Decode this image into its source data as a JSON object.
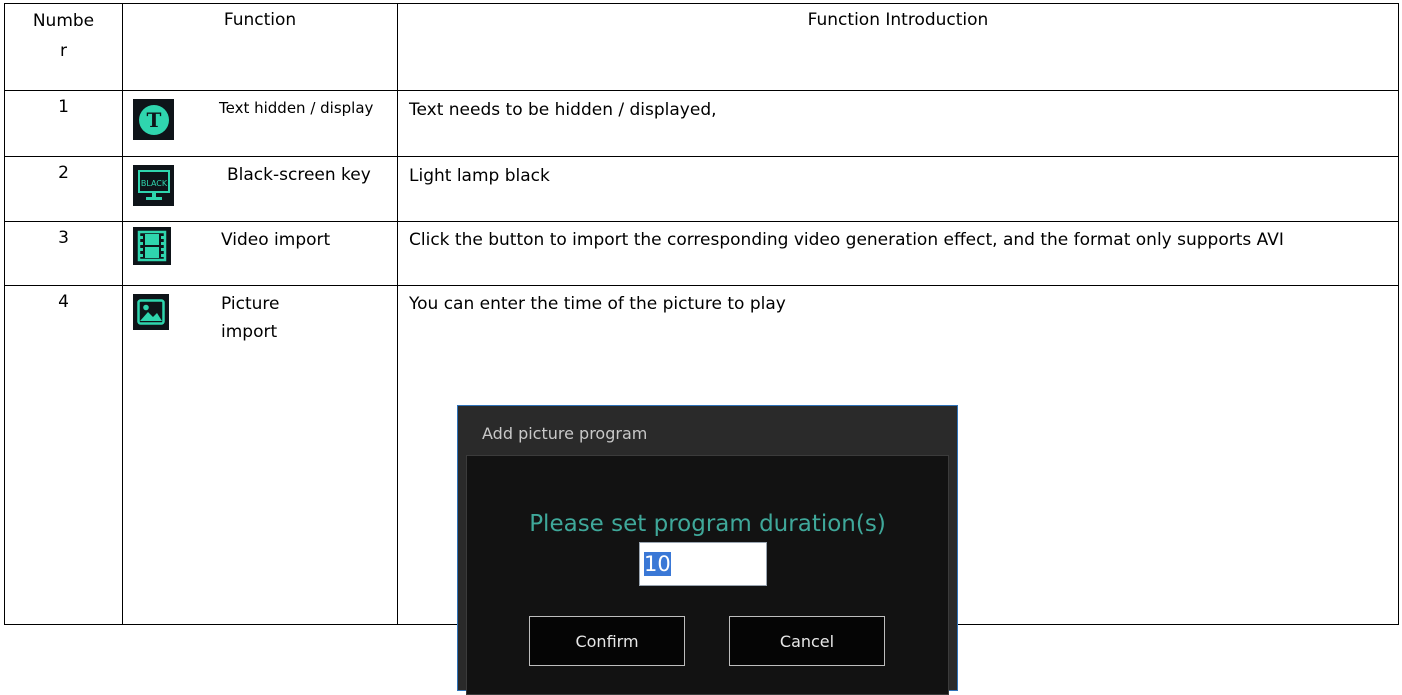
{
  "table": {
    "headers": {
      "number": "Numbe r",
      "function": "Function",
      "intro": "Function Introduction"
    },
    "rows": [
      {
        "number": "1",
        "icon": "text-t-icon",
        "function": "Text hidden / display",
        "intro": "Text needs to be hidden / displayed,"
      },
      {
        "number": "2",
        "icon": "black-screen-monitor-icon",
        "icon_text": "BLACK",
        "function": "Black-screen key",
        "intro": "Light lamp black"
      },
      {
        "number": "3",
        "icon": "film-strip-icon",
        "function": "Video import",
        "intro": "Click the button to import the corresponding video generation effect, and the format only supports AVI"
      },
      {
        "number": "4",
        "icon": "picture-icon",
        "function": "Picture import",
        "intro": "You can enter the time of the picture to play"
      }
    ]
  },
  "dialog": {
    "title": "Add picture program",
    "prompt": "Please set program duration(s)",
    "input_value": "10",
    "confirm_label": "Confirm",
    "cancel_label": "Cancel"
  },
  "colors": {
    "icon_bg": "#0e1419",
    "icon_accent": "#2fd5ae",
    "dialog_prompt": "#3fa89a",
    "dialog_border": "#2f72b8",
    "selection": "#3a78d6"
  }
}
